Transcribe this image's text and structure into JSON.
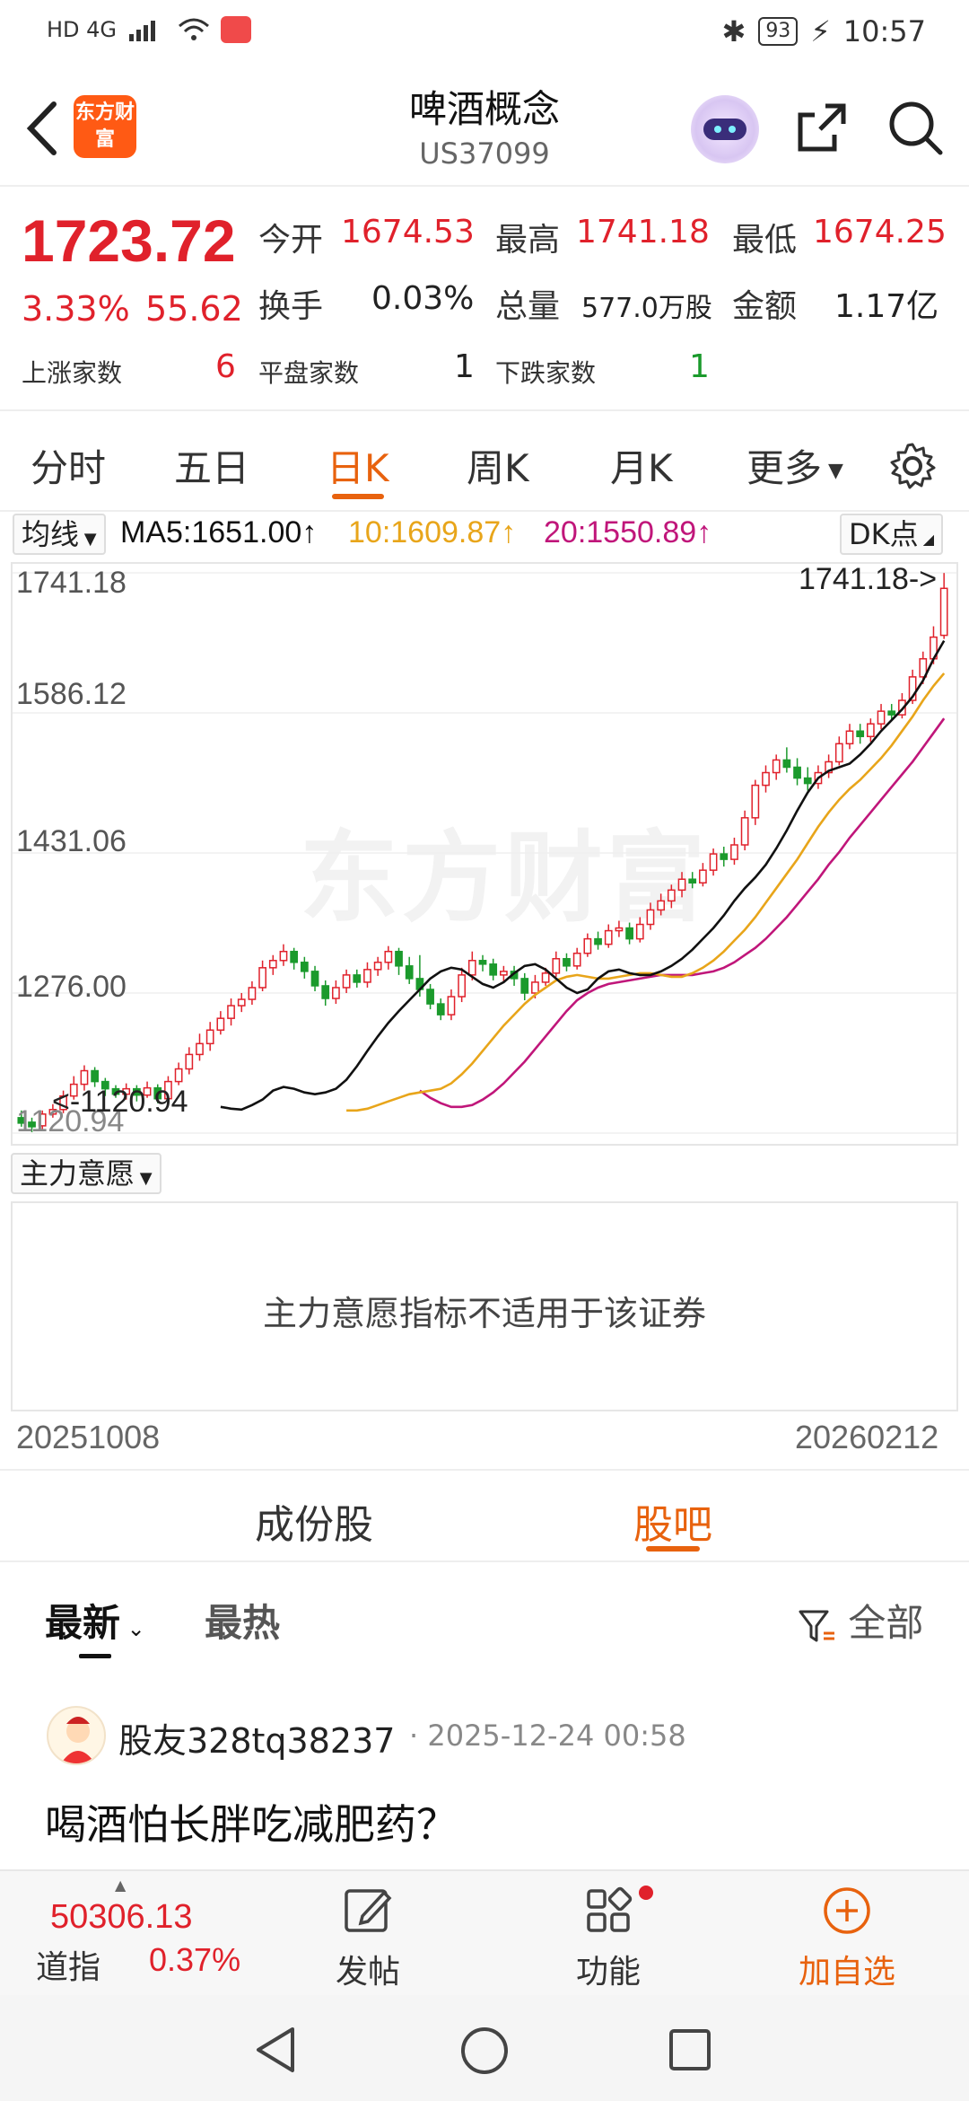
{
  "status_bar": {
    "left_text": "HD 4G",
    "battery": "93",
    "time": "10:57"
  },
  "header": {
    "logo_text": "东方财富",
    "title": "啤酒概念",
    "code": "US37099"
  },
  "quote": {
    "price": "1723.72",
    "change_pct": "3.33%",
    "change_val": "55.62",
    "open_label": "今开",
    "open": "1674.53",
    "high_label": "最高",
    "high": "1741.18",
    "low_label": "最低",
    "low": "1674.25",
    "turnover_label": "换手",
    "turnover": "0.03%",
    "volume_label": "总量",
    "volume": "577.0万股",
    "amount_label": "金额",
    "amount": "1.17亿",
    "up_label": "上涨家数",
    "up_count": "6",
    "flat_label": "平盘家数",
    "flat_count": "1",
    "down_label": "下跌家数",
    "down_count": "1"
  },
  "chart_tabs": [
    "分时",
    "五日",
    "日K",
    "周K",
    "月K",
    "更多"
  ],
  "active_chart_tab": "日K",
  "ma_row": {
    "selector": "均线",
    "ma5": "MA5:1651.00",
    "ma10": "10:1609.87",
    "ma20": "20:1550.89",
    "dk": "DK点",
    "ma5_color": "#111111",
    "ma10_color": "#e8a51a",
    "ma20_color": "#c0167a"
  },
  "chart_labels": {
    "y_ticks": [
      "1741.18",
      "1586.12",
      "1431.06",
      "1276.00",
      "1120.94"
    ],
    "high_marker": "1741.18->",
    "low_marker": "<-1120.94",
    "watermark": "东方财富"
  },
  "chart_data": {
    "type": "candlestick",
    "ylim": [
      1120.94,
      1741.18
    ],
    "y_ticks": [
      1741.18,
      1586.12,
      1431.06,
      1276.0,
      1120.94
    ],
    "x_start": "20251008",
    "x_end": "20260212",
    "candles": [
      [
        1138,
        1132,
        1146,
        1128
      ],
      [
        1133,
        1128,
        1138,
        1122
      ],
      [
        1129,
        1142,
        1146,
        1125
      ],
      [
        1142,
        1147,
        1153,
        1138
      ],
      [
        1147,
        1162,
        1168,
        1143
      ],
      [
        1162,
        1175,
        1184,
        1158
      ],
      [
        1175,
        1190,
        1196,
        1168
      ],
      [
        1190,
        1178,
        1194,
        1172
      ],
      [
        1178,
        1170,
        1182,
        1162
      ],
      [
        1170,
        1164,
        1174,
        1160
      ],
      [
        1164,
        1170,
        1176,
        1158
      ],
      [
        1170,
        1163,
        1174,
        1156
      ],
      [
        1163,
        1171,
        1178,
        1160
      ],
      [
        1171,
        1159,
        1175,
        1154
      ],
      [
        1159,
        1178,
        1184,
        1155
      ],
      [
        1178,
        1192,
        1199,
        1174
      ],
      [
        1192,
        1208,
        1216,
        1186
      ],
      [
        1208,
        1220,
        1231,
        1201
      ],
      [
        1220,
        1235,
        1244,
        1212
      ],
      [
        1235,
        1248,
        1256,
        1230
      ],
      [
        1248,
        1262,
        1270,
        1240
      ],
      [
        1262,
        1269,
        1276,
        1255
      ],
      [
        1269,
        1282,
        1289,
        1263
      ],
      [
        1282,
        1304,
        1312,
        1278
      ],
      [
        1304,
        1312,
        1318,
        1296
      ],
      [
        1312,
        1322,
        1330,
        1306
      ],
      [
        1322,
        1310,
        1326,
        1302
      ],
      [
        1310,
        1300,
        1316,
        1292
      ],
      [
        1300,
        1284,
        1306,
        1278
      ],
      [
        1284,
        1270,
        1290,
        1262
      ],
      [
        1270,
        1282,
        1290,
        1264
      ],
      [
        1282,
        1296,
        1302,
        1276
      ],
      [
        1296,
        1288,
        1302,
        1282
      ],
      [
        1288,
        1302,
        1310,
        1282
      ],
      [
        1302,
        1310,
        1316,
        1295
      ],
      [
        1310,
        1322,
        1328,
        1302
      ],
      [
        1322,
        1306,
        1326,
        1296
      ],
      [
        1306,
        1292,
        1316,
        1286
      ],
      [
        1292,
        1280,
        1318,
        1272
      ],
      [
        1280,
        1264,
        1286,
        1258
      ],
      [
        1264,
        1252,
        1270,
        1246
      ],
      [
        1252,
        1272,
        1280,
        1246
      ],
      [
        1272,
        1296,
        1304,
        1266
      ],
      [
        1296,
        1312,
        1322,
        1290
      ],
      [
        1312,
        1308,
        1318,
        1300
      ],
      [
        1308,
        1296,
        1314,
        1290
      ],
      [
        1296,
        1300,
        1306,
        1288
      ],
      [
        1300,
        1292,
        1306,
        1284
      ],
      [
        1292,
        1276,
        1298,
        1268
      ],
      [
        1276,
        1288,
        1296,
        1270
      ],
      [
        1288,
        1298,
        1304,
        1284
      ],
      [
        1298,
        1314,
        1322,
        1294
      ],
      [
        1314,
        1306,
        1320,
        1300
      ],
      [
        1306,
        1320,
        1326,
        1302
      ],
      [
        1320,
        1336,
        1342,
        1316
      ],
      [
        1336,
        1330,
        1344,
        1324
      ],
      [
        1330,
        1345,
        1352,
        1326
      ],
      [
        1345,
        1348,
        1356,
        1338
      ],
      [
        1348,
        1336,
        1354,
        1330
      ],
      [
        1336,
        1352,
        1360,
        1332
      ],
      [
        1352,
        1368,
        1376,
        1346
      ],
      [
        1368,
        1378,
        1386,
        1362
      ],
      [
        1378,
        1390,
        1396,
        1370
      ],
      [
        1390,
        1402,
        1410,
        1382
      ],
      [
        1402,
        1398,
        1410,
        1392
      ],
      [
        1398,
        1412,
        1420,
        1394
      ],
      [
        1412,
        1430,
        1436,
        1406
      ],
      [
        1430,
        1424,
        1438,
        1416
      ],
      [
        1424,
        1440,
        1448,
        1418
      ],
      [
        1440,
        1470,
        1478,
        1434
      ],
      [
        1470,
        1506,
        1512,
        1462
      ],
      [
        1506,
        1520,
        1528,
        1498
      ],
      [
        1520,
        1534,
        1540,
        1512
      ],
      [
        1534,
        1526,
        1548,
        1520
      ],
      [
        1526,
        1514,
        1536,
        1506
      ],
      [
        1514,
        1508,
        1526,
        1500
      ],
      [
        1508,
        1520,
        1528,
        1502
      ],
      [
        1520,
        1532,
        1540,
        1514
      ],
      [
        1532,
        1552,
        1560,
        1528
      ],
      [
        1552,
        1566,
        1574,
        1546
      ],
      [
        1566,
        1560,
        1574,
        1552
      ],
      [
        1560,
        1574,
        1580,
        1554
      ],
      [
        1574,
        1588,
        1596,
        1568
      ],
      [
        1588,
        1584,
        1596,
        1578
      ],
      [
        1584,
        1600,
        1608,
        1580
      ],
      [
        1600,
        1626,
        1634,
        1596
      ],
      [
        1626,
        1646,
        1654,
        1618
      ],
      [
        1646,
        1670,
        1682,
        1640
      ],
      [
        1672,
        1724,
        1741,
        1668
      ]
    ],
    "ma5": [
      1150,
      1148,
      1147,
      1152,
      1158,
      1168,
      1172,
      1170,
      1166,
      1164,
      1166,
      1170,
      1180,
      1195,
      1212,
      1228,
      1243,
      1256,
      1268,
      1280,
      1292,
      1300,
      1304,
      1302,
      1294,
      1286,
      1282,
      1288,
      1298,
      1306,
      1308,
      1302,
      1292,
      1282,
      1276,
      1280,
      1292,
      1300,
      1302,
      1298,
      1296,
      1296,
      1300,
      1306,
      1314,
      1324,
      1336,
      1348,
      1362,
      1378,
      1392,
      1404,
      1418,
      1436,
      1456,
      1478,
      1498,
      1514,
      1522,
      1526,
      1530,
      1540,
      1552,
      1566,
      1578,
      1590,
      1604,
      1622,
      1646,
      1666
    ],
    "ma10": [
      1146,
      1146,
      1148,
      1152,
      1156,
      1160,
      1164,
      1166,
      1168,
      1170,
      1176,
      1186,
      1198,
      1212,
      1226,
      1240,
      1252,
      1264,
      1274,
      1282,
      1290,
      1294,
      1296,
      1294,
      1292,
      1292,
      1294,
      1296,
      1298,
      1298,
      1296,
      1294,
      1294,
      1298,
      1304,
      1312,
      1322,
      1334,
      1346,
      1360,
      1376,
      1392,
      1408,
      1424,
      1442,
      1460,
      1476,
      1490,
      1502,
      1512,
      1524,
      1536,
      1550,
      1566,
      1582,
      1600,
      1616,
      1630
    ],
    "ma20": [
      1168,
      1160,
      1154,
      1150,
      1150,
      1152,
      1158,
      1166,
      1176,
      1188,
      1200,
      1214,
      1228,
      1242,
      1256,
      1268,
      1276,
      1282,
      1286,
      1288,
      1290,
      1292,
      1294,
      1296,
      1296,
      1296,
      1296,
      1298,
      1300,
      1304,
      1310,
      1318,
      1326,
      1336,
      1348,
      1360,
      1374,
      1388,
      1402,
      1418,
      1432,
      1448,
      1462,
      1476,
      1490,
      1504,
      1518,
      1532,
      1548,
      1564,
      1580
    ]
  },
  "indicator": {
    "selector": "主力意愿",
    "message": "主力意愿指标不适用于该证券"
  },
  "dates": {
    "start": "20251008",
    "end": "20260212"
  },
  "section_tabs": [
    "成份股",
    "股吧"
  ],
  "active_section_tab": "股吧",
  "filter": {
    "latest": "最新",
    "hot": "最热",
    "all": "全部"
  },
  "post": {
    "user": "股友328tq38237",
    "time": "· 2025-12-24 00:58",
    "body": "喝酒怕长胖吃减肥药？"
  },
  "toolbar": {
    "index_value": "50306.13",
    "index_name": "道指",
    "index_pct": "0.37%",
    "post_label": "发帖",
    "func_label": "功能",
    "add_label": "加自选"
  },
  "colors": {
    "red": "#e0212b",
    "green": "#1b9a2c",
    "accent": "#e8620e"
  }
}
